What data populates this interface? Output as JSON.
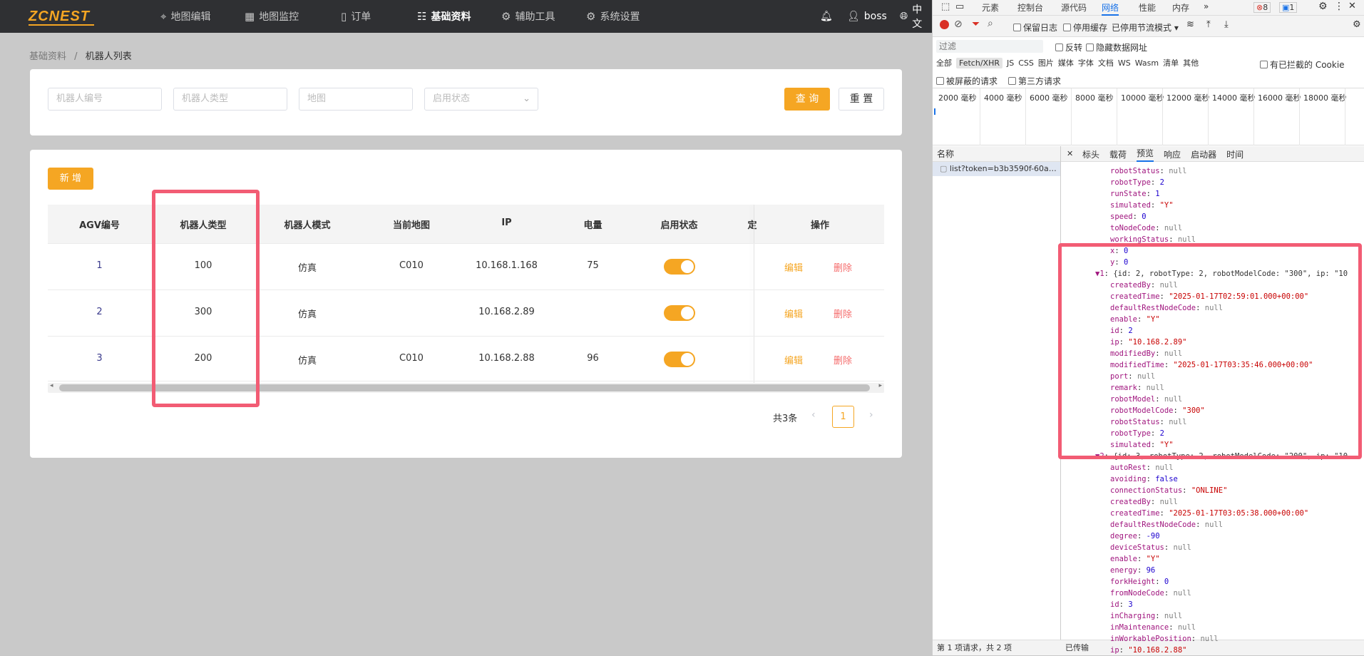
{
  "app": {
    "logo": "ZCNEST",
    "nav": [
      {
        "label": "地图编辑",
        "icon": "map-pin-icon"
      },
      {
        "label": "地图监控",
        "icon": "monitor-chart-icon"
      },
      {
        "label": "订单",
        "icon": "document-icon"
      },
      {
        "label": "基础资料",
        "icon": "sliders-icon"
      },
      {
        "label": "辅助工具",
        "icon": "gear-icon"
      },
      {
        "label": "系统设置",
        "icon": "settings-icon"
      }
    ],
    "user": "boss",
    "lang": "中文",
    "breadcrumb": {
      "parent": "基础资料",
      "sep": "/",
      "current": "机器人列表"
    },
    "search": {
      "robot_code_placeholder": "机器人编号",
      "robot_type_placeholder": "机器人类型",
      "map_placeholder": "地图",
      "enable_placeholder": "启用状态",
      "query": "查 询",
      "reset": "重 置"
    },
    "add_button": "新 增",
    "table": {
      "headers": [
        "AGV编号",
        "机器人类型",
        "机器人模式",
        "当前地图",
        "IP",
        "电量",
        "启用状态",
        "定",
        "操作"
      ],
      "rows": [
        {
          "id": "1",
          "type": "100",
          "mode": "仿真",
          "map": "C010",
          "ip": "10.168.1.168",
          "battery": "75",
          "enabled": true,
          "edit": "编辑",
          "delete": "删除"
        },
        {
          "id": "2",
          "type": "300",
          "mode": "仿真",
          "map": "",
          "ip": "10.168.2.89",
          "battery": "",
          "enabled": true,
          "edit": "编辑",
          "delete": "删除"
        },
        {
          "id": "3",
          "type": "200",
          "mode": "仿真",
          "map": "C010",
          "ip": "10.168.2.88",
          "battery": "96",
          "enabled": true,
          "edit": "编辑",
          "delete": "删除"
        }
      ]
    },
    "pagination": {
      "total": "共3条",
      "page": "1"
    }
  },
  "devtools": {
    "tabs": [
      "元素",
      "控制台",
      "源代码",
      "网络",
      "性能",
      "内存"
    ],
    "active_tab": "网络",
    "errors": "8",
    "messages": "1",
    "toolbar": {
      "preserve_log": "保留日志",
      "disable_cache": "停用缓存",
      "throttle": "已停用节流模式"
    },
    "filter_placeholder": "过滤",
    "invert": "反转",
    "hide_data_urls": "隐藏数据网址",
    "types": [
      "全部",
      "Fetch/XHR",
      "JS",
      "CSS",
      "图片",
      "媒体",
      "字体",
      "文档",
      "WS",
      "Wasm",
      "清单",
      "其他"
    ],
    "blocked_cookies": "有已拦截的 Cookie",
    "blocked_requests": "被屏蔽的请求",
    "third_party": "第三方请求",
    "timeline": [
      "2000 毫秒",
      "4000 毫秒",
      "6000 毫秒",
      "8000 毫秒",
      "10000 毫秒",
      "12000 毫秒",
      "14000 毫秒",
      "16000 毫秒",
      "18000 毫秒"
    ],
    "name_header": "名称",
    "request": "list?token=b3b3590f-60a…",
    "detail_tabs": [
      "标头",
      "载荷",
      "预览",
      "响应",
      "启动器",
      "时间"
    ],
    "active_detail_tab": "预览",
    "status": "第 1 项请求，共 2 项",
    "status2": "已传输",
    "preview_lines": [
      [
        "robotStatus",
        "null",
        "nl"
      ],
      [
        "robotType",
        "2",
        "n"
      ],
      [
        "runState",
        "1",
        "n"
      ],
      [
        "simulated",
        "\"Y\"",
        "s"
      ],
      [
        "speed",
        "0",
        "n"
      ],
      [
        "toNodeCode",
        "null",
        "nl"
      ],
      [
        "workingStatus",
        "null",
        "nl"
      ],
      [
        "x",
        "0",
        "n"
      ],
      [
        "y",
        "0",
        "n"
      ],
      [
        "▼1",
        "{id: 2, robotType: 2, robotModelCode: \"300\", ip: \"10",
        "h"
      ],
      [
        "createdBy",
        "null",
        "nl"
      ],
      [
        "createdTime",
        "\"2025-01-17T02:59:01.000+00:00\"",
        "s"
      ],
      [
        "defaultRestNodeCode",
        "null",
        "nl"
      ],
      [
        "enable",
        "\"Y\"",
        "s"
      ],
      [
        "id",
        "2",
        "n"
      ],
      [
        "ip",
        "\"10.168.2.89\"",
        "s"
      ],
      [
        "modifiedBy",
        "null",
        "nl"
      ],
      [
        "modifiedTime",
        "\"2025-01-17T03:35:46.000+00:00\"",
        "s"
      ],
      [
        "port",
        "null",
        "nl"
      ],
      [
        "remark",
        "null",
        "nl"
      ],
      [
        "robotModel",
        "null",
        "nl"
      ],
      [
        "robotModelCode",
        "\"300\"",
        "s"
      ],
      [
        "robotStatus",
        "null",
        "nl"
      ],
      [
        "robotType",
        "2",
        "n"
      ],
      [
        "simulated",
        "\"Y\"",
        "s"
      ],
      [
        "▼2",
        "{id: 3, robotType: 2, robotModelCode: \"200\", ip: \"10",
        "h"
      ],
      [
        "autoRest",
        "null",
        "nl"
      ],
      [
        "avoiding",
        "false",
        "n"
      ],
      [
        "connectionStatus",
        "\"ONLINE\"",
        "s"
      ],
      [
        "createdBy",
        "null",
        "nl"
      ],
      [
        "createdTime",
        "\"2025-01-17T03:05:38.000+00:00\"",
        "s"
      ],
      [
        "defaultRestNodeCode",
        "null",
        "nl"
      ],
      [
        "degree",
        "-90",
        "n"
      ],
      [
        "deviceStatus",
        "null",
        "nl"
      ],
      [
        "enable",
        "\"Y\"",
        "s"
      ],
      [
        "energy",
        "96",
        "n"
      ],
      [
        "forkHeight",
        "0",
        "n"
      ],
      [
        "fromNodeCode",
        "null",
        "nl"
      ],
      [
        "id",
        "3",
        "n"
      ],
      [
        "inCharging",
        "null",
        "nl"
      ],
      [
        "inMaintenance",
        "null",
        "nl"
      ],
      [
        "inWorkablePosition",
        "null",
        "nl"
      ],
      [
        "ip",
        "\"10.168.2.88\"",
        "s"
      ]
    ]
  },
  "colors": {
    "accent": "#f5a623",
    "danger": "#f56c6c",
    "highlight_box": "#f25c74",
    "topbar": "#2f3033"
  }
}
